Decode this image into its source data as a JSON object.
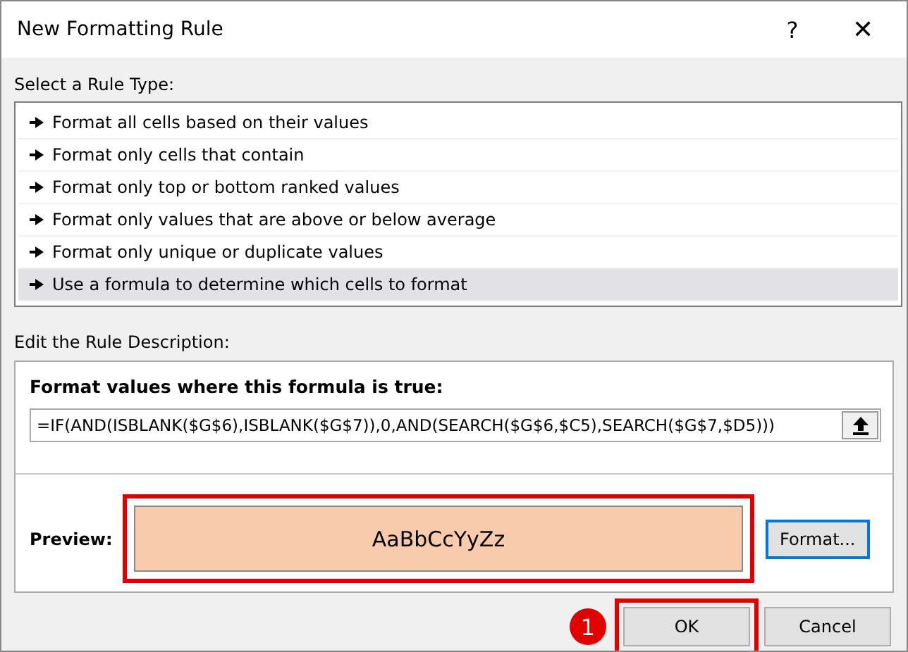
{
  "window": {
    "title": "New Formatting Rule",
    "help": "?",
    "close": "✕"
  },
  "rule_type": {
    "label": "Select a Rule Type:",
    "items": [
      {
        "label": "Format all cells based on their values",
        "selected": false
      },
      {
        "label": "Format only cells that contain",
        "selected": false
      },
      {
        "label": "Format only top or bottom ranked values",
        "selected": false
      },
      {
        "label": "Format only values that are above or below average",
        "selected": false
      },
      {
        "label": "Format only unique or duplicate values",
        "selected": false
      },
      {
        "label": "Use a formula to determine which cells to format",
        "selected": true
      }
    ]
  },
  "description": {
    "label": "Edit the Rule Description:",
    "formula_label": "Format values where this formula is true:",
    "formula": "=IF(AND(ISBLANK($G$6),ISBLANK($G$7)),0,AND(SEARCH($G$6,$C5),SEARCH($G$7,$D5)))",
    "preview_label": "Preview:",
    "preview_text": "AaBbCcYyZz",
    "format_button": "Format..."
  },
  "buttons": [
    {
      "label": "OK",
      "highlighted": true
    },
    {
      "label": "Cancel",
      "highlighted": false
    }
  ],
  "step_badge": "1"
}
